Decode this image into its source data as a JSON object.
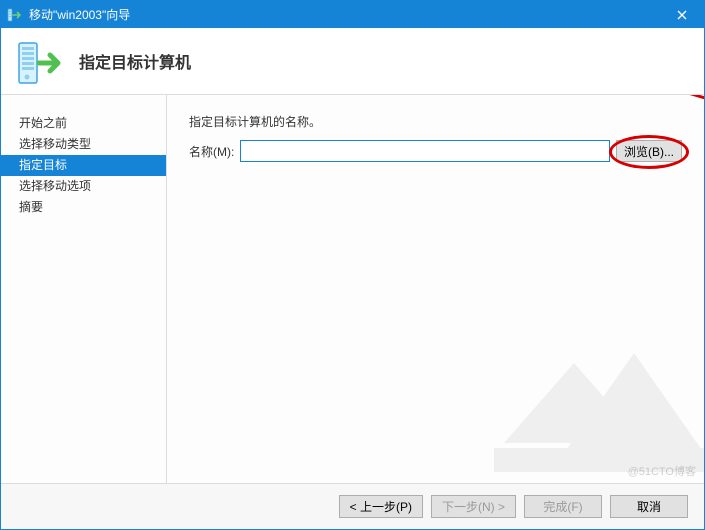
{
  "window": {
    "title": "移动\"win2003\"向导"
  },
  "header": {
    "title": "指定目标计算机"
  },
  "sidebar": {
    "items": [
      {
        "label": "开始之前",
        "selected": false
      },
      {
        "label": "选择移动类型",
        "selected": false
      },
      {
        "label": "指定目标",
        "selected": true
      },
      {
        "label": "选择移动选项",
        "selected": false
      },
      {
        "label": "摘要",
        "selected": false
      }
    ]
  },
  "content": {
    "instruction": "指定目标计算机的名称。",
    "name_label": "名称(M):",
    "name_value": "",
    "browse_label": "浏览(B)..."
  },
  "footer": {
    "prev_label": "< 上一步(P)",
    "next_label": "下一步(N) >",
    "finish_label": "完成(F)",
    "cancel_label": "取消"
  },
  "watermark": {
    "text": "@51CTO博客"
  }
}
